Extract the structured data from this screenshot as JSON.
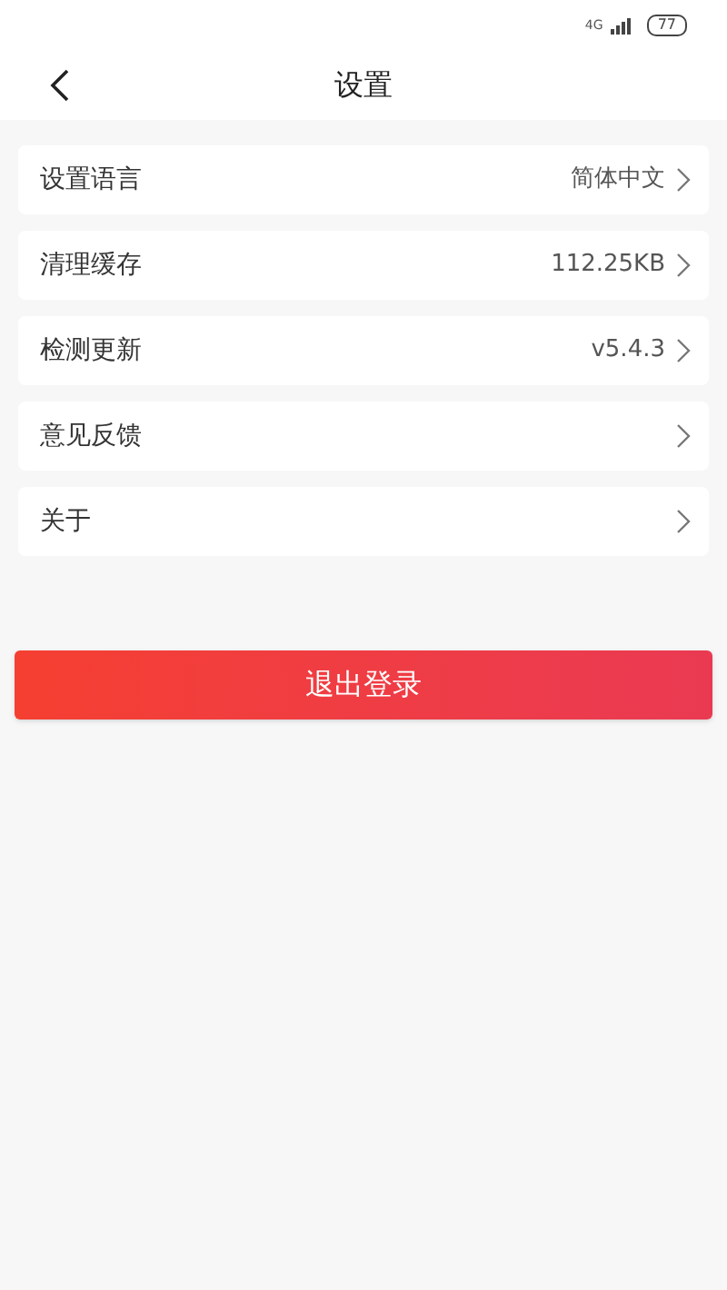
{
  "status_bar": {
    "network": "4G",
    "battery": "77"
  },
  "header": {
    "title": "设置"
  },
  "items": [
    {
      "label": "设置语言",
      "value": "简体中文"
    },
    {
      "label": "清理缓存",
      "value": "112.25KB"
    },
    {
      "label": "检测更新",
      "value": "v5.4.3"
    },
    {
      "label": "意见反馈"
    },
    {
      "label": "关于"
    }
  ],
  "logout_button": "退出登录"
}
